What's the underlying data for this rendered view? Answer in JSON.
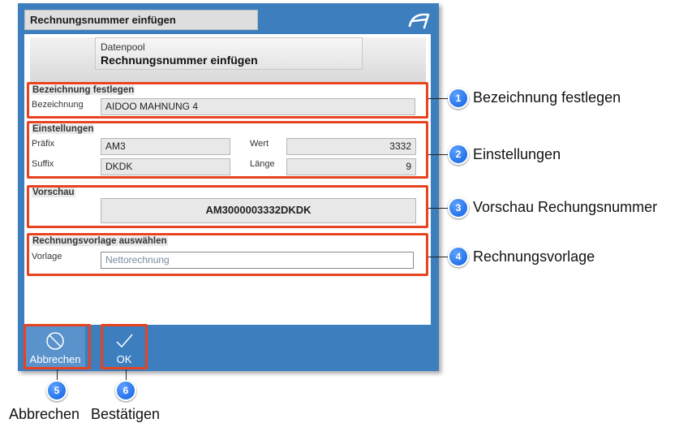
{
  "dialog": {
    "title": "Rechnungsnummer einfügen",
    "header_sub": "Datenpool",
    "header_main": "Rechnungsnummer einfügen"
  },
  "groups": {
    "bezeichnung": {
      "title": "Bezeichnung festlegen",
      "label": "Bezeichnung",
      "value": "AIDOO MAHNUNG 4"
    },
    "einstellungen": {
      "title": "Einstellungen",
      "praefix_label": "Präfix",
      "praefix_value": "AM3",
      "suffix_label": "Suffix",
      "suffix_value": "DKDK",
      "wert_label": "Wert",
      "wert_value": "3332",
      "laenge_label": "Länge",
      "laenge_value": "9"
    },
    "vorschau": {
      "title": "Vorschau",
      "value": "AM3000003332DKDK"
    },
    "vorlage": {
      "title": "Rechnungsvorlage auswählen",
      "label": "Vorlage",
      "placeholder": "Nettorechnung"
    }
  },
  "buttons": {
    "cancel": "Abbrechen",
    "ok": "OK"
  },
  "callouts": [
    {
      "num": "1",
      "text": "Bezeichnung festlegen"
    },
    {
      "num": "2",
      "text": "Einstellungen"
    },
    {
      "num": "3",
      "text": "Vorschau Rechungsnummer"
    },
    {
      "num": "4",
      "text": "Rechnungsvorlage"
    },
    {
      "num": "5",
      "text": "Abbrechen"
    },
    {
      "num": "6",
      "text": "Bestätigen"
    }
  ],
  "colors": {
    "accent": "#3d7ebf",
    "highlight": "#e8431f",
    "callout": "#0c5fe0"
  },
  "icons": {
    "logo": "app-logo-icon",
    "cancel": "cancel-circle-icon",
    "ok": "checkmark-icon"
  }
}
